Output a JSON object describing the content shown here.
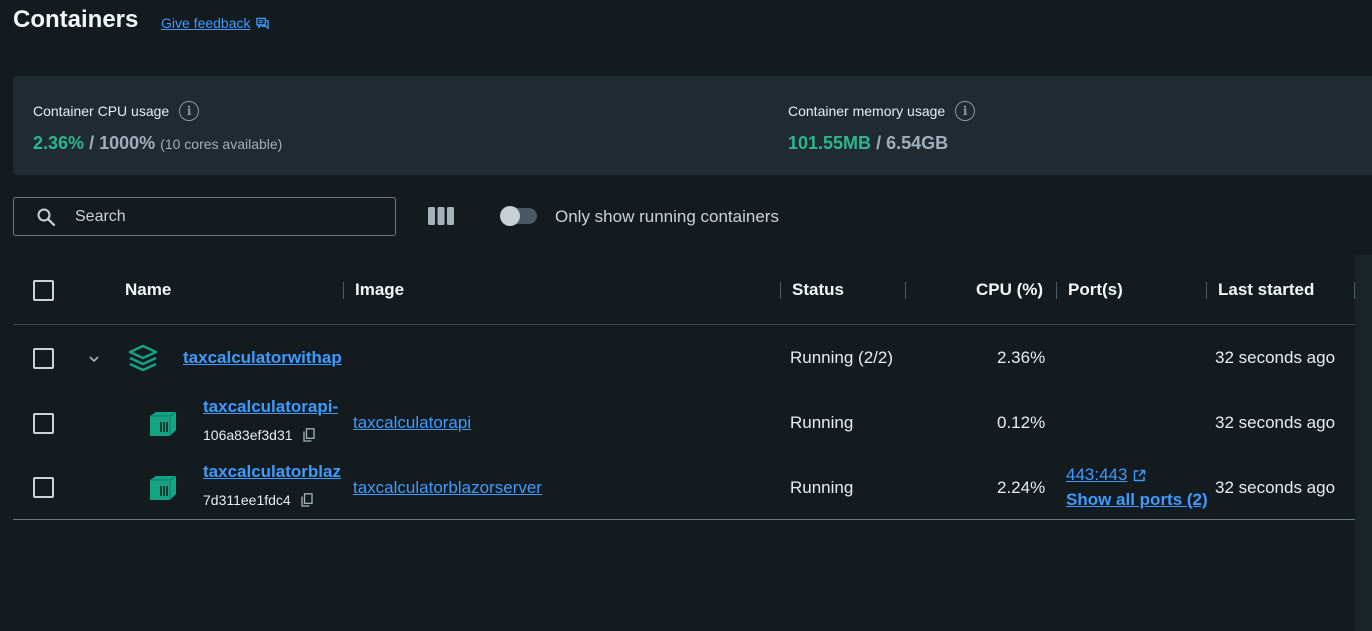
{
  "header": {
    "title": "Containers",
    "feedback_label": "Give feedback"
  },
  "stats": {
    "cpu": {
      "label": "Container CPU usage",
      "used": "2.36%",
      "separator": "/",
      "total": "1000%",
      "note": "(10 cores available)"
    },
    "memory": {
      "label": "Container memory usage",
      "used": "101.55MB",
      "separator": "/",
      "total": "6.54GB"
    }
  },
  "toolbar": {
    "search_placeholder": "Search",
    "running_toggle_label": "Only show running containers",
    "running_toggle_on": false
  },
  "table": {
    "columns": [
      "Name",
      "Image",
      "Status",
      "CPU (%)",
      "Port(s)",
      "Last started"
    ],
    "rows": [
      {
        "name": "taxcalculatorwithap",
        "image": "",
        "status": "Running (2/2)",
        "cpu": "2.36%",
        "ports": "",
        "last_started": "32 seconds ago",
        "is_group": true
      },
      {
        "name": "taxcalculatorapi-",
        "id": "106a83ef3d31",
        "image": "taxcalculatorapi",
        "status": "Running",
        "cpu": "0.12%",
        "ports": "",
        "last_started": "32 seconds ago"
      },
      {
        "name": "taxcalculatorblaz",
        "id": "7d311ee1fdc4",
        "image": "taxcalculatorblazorserver",
        "status": "Running",
        "cpu": "2.24%",
        "ports": "443:443",
        "show_all_ports": "Show all ports (2)",
        "last_started": "32 seconds ago"
      }
    ]
  },
  "colors": {
    "background": "#141b1f",
    "panel": "#1f2a31",
    "accent_green": "#2cb68f",
    "link_blue": "#3d9bff",
    "container_icon": "#14a383"
  }
}
